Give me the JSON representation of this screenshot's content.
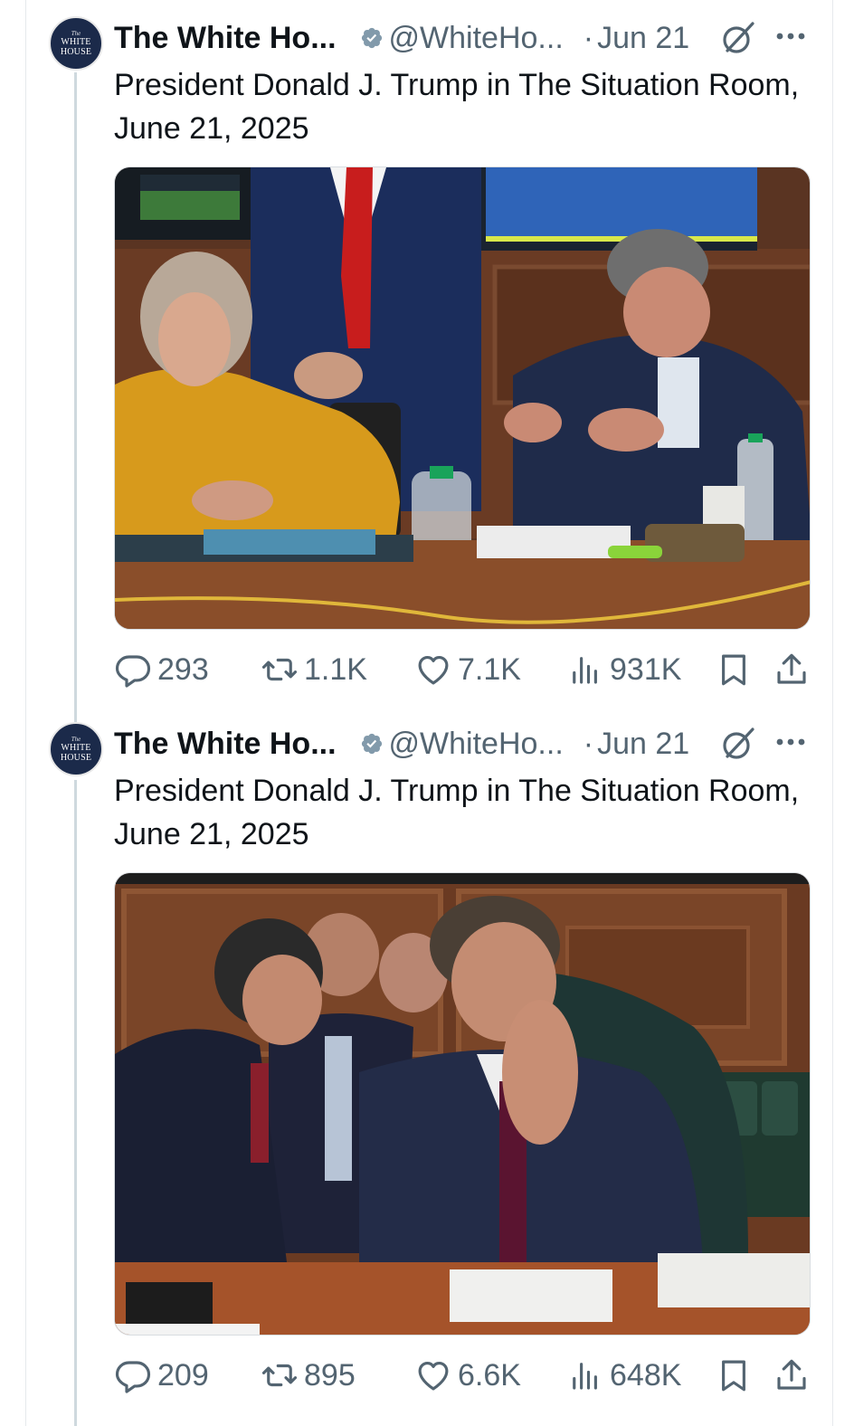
{
  "tweets": [
    {
      "account": {
        "avatar_text_small": "The",
        "avatar_text": "WHITE HOUSE",
        "name": "The White Ho...",
        "handle": "@WhiteHo...",
        "separator": "·",
        "date": "Jun 21"
      },
      "text": "President Donald J. Trump in The Situation Room, June 21, 2025",
      "stats": {
        "replies": "293",
        "reposts": "1.1K",
        "likes": "7.1K",
        "views": "931K"
      }
    },
    {
      "account": {
        "avatar_text_small": "The",
        "avatar_text": "WHITE HOUSE",
        "name": "The White Ho...",
        "handle": "@WhiteHo...",
        "separator": "·",
        "date": "Jun 21"
      },
      "text": "President Donald J. Trump in The Situation Room, June 21, 2025",
      "stats": {
        "replies": "209",
        "reposts": "895",
        "likes": "6.6K",
        "views": "648K"
      }
    }
  ],
  "icons": {
    "verified": "verified-badge-icon",
    "grok": "grok-icon",
    "more": "more-options-icon",
    "reply": "reply-icon",
    "retweet": "retweet-icon",
    "like": "heart-icon",
    "views": "views-chart-icon",
    "bookmark": "bookmark-icon",
    "share": "share-icon"
  },
  "colors": {
    "text_primary": "#0f1419",
    "text_secondary": "#536471",
    "verified": "#829aab",
    "avatar_bg": "#1b2a4a",
    "thread_line": "#cfd9de"
  }
}
